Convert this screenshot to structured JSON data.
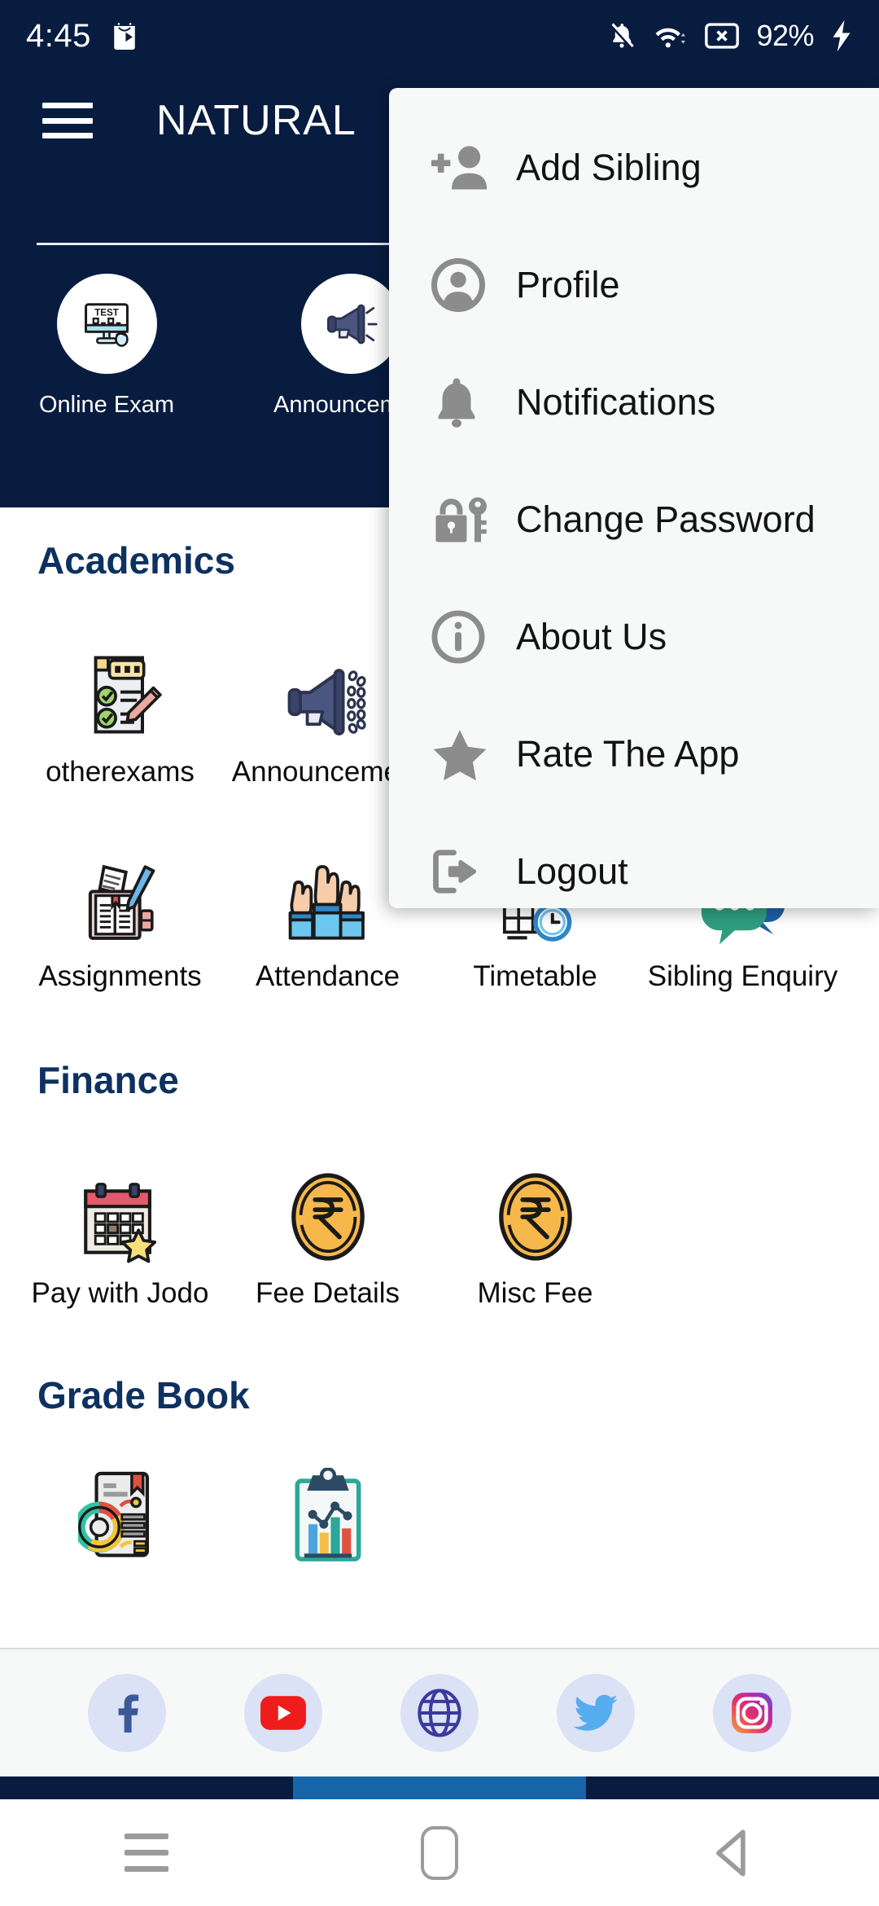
{
  "status_bar": {
    "time": "4:45",
    "battery": "92%",
    "icons": [
      "play-store-icon",
      "bell-off-icon",
      "wifi-icon",
      "no-sim-icon",
      "charging-bolt-icon"
    ]
  },
  "header": {
    "menu_icon": "hamburger-icon",
    "title": "NATURAL",
    "background_color": "#081c40",
    "quick_links": [
      {
        "label": "Online Exam",
        "icon": "online-exam-monitor-icon"
      },
      {
        "label": "Announcement",
        "icon": "announcement-megaphone-icon"
      }
    ]
  },
  "overflow_menu": {
    "items": [
      {
        "label": "Add Sibling",
        "icon": "person-add-icon"
      },
      {
        "label": "Profile",
        "icon": "account-circle-icon"
      },
      {
        "label": "Notifications",
        "icon": "bell-icon"
      },
      {
        "label": "Change Password",
        "icon": "lock-key-icon"
      },
      {
        "label": "About Us",
        "icon": "info-circle-icon"
      },
      {
        "label": "Rate The App",
        "icon": "star-icon"
      },
      {
        "label": "Logout",
        "icon": "logout-arrow-icon"
      }
    ]
  },
  "sections": [
    {
      "title": "Academics",
      "rows": [
        [
          {
            "label": "otherexams",
            "icon": "exam-checklist-icon"
          },
          {
            "label": "Announcement",
            "icon": "megaphone-icon"
          },
          {
            "label": "",
            "icon": ""
          },
          {
            "label": "",
            "icon": ""
          }
        ],
        [
          {
            "label": "Assignments",
            "icon": "assignment-book-icon"
          },
          {
            "label": "Attendance",
            "icon": "raised-hands-icon"
          },
          {
            "label": "Timetable",
            "icon": "timetable-clock-icon"
          },
          {
            "label": "Sibling Enquiry",
            "icon": "chat-bubbles-icon"
          }
        ]
      ]
    },
    {
      "title": "Finance",
      "rows": [
        [
          {
            "label": "Pay with Jodo",
            "icon": "calendar-star-icon"
          },
          {
            "label": "Fee Details",
            "icon": "rupee-coin-icon"
          },
          {
            "label": "Misc Fee",
            "icon": "rupee-coin-icon"
          }
        ]
      ]
    },
    {
      "title": "Grade Book",
      "rows": [
        [
          {
            "label": "",
            "icon": "report-donut-icon"
          },
          {
            "label": "",
            "icon": "clipboard-chart-icon"
          }
        ]
      ]
    }
  ],
  "social_bar": {
    "items": [
      {
        "name": "facebook",
        "icon": "facebook-icon"
      },
      {
        "name": "youtube",
        "icon": "youtube-icon"
      },
      {
        "name": "website",
        "icon": "globe-icon"
      },
      {
        "name": "twitter",
        "icon": "twitter-icon"
      },
      {
        "name": "instagram",
        "icon": "instagram-icon"
      }
    ]
  },
  "navigation_bar": {
    "buttons": [
      {
        "name": "recents",
        "icon": "recents-icon"
      },
      {
        "name": "home",
        "icon": "home-icon"
      },
      {
        "name": "back",
        "icon": "back-triangle-icon"
      }
    ]
  },
  "colors": {
    "navy": "#081c40",
    "section_heading": "#0d3160",
    "menu_bg": "#f7f8f8",
    "accent_blue": "#1565a8"
  }
}
